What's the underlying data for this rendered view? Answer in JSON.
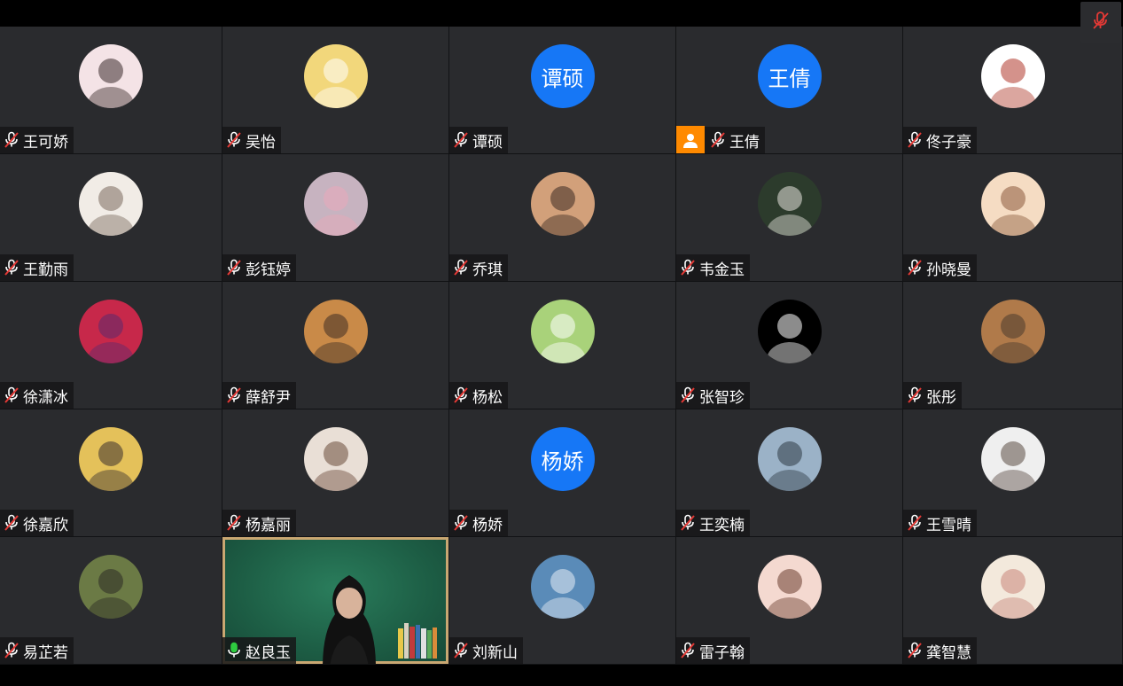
{
  "participants": [
    {
      "name": "王可娇",
      "avatar": "photo-girl",
      "colors": [
        "#f4e3e6",
        "#3a2b2b"
      ]
    },
    {
      "name": "吴怡",
      "avatar": "cartoon-egg",
      "colors": [
        "#f2d77b",
        "#ffffff"
      ]
    },
    {
      "name": "谭硕",
      "avatar_text": "谭硕"
    },
    {
      "name": "王倩",
      "avatar_text": "王倩",
      "host": true
    },
    {
      "name": "佟子豪",
      "avatar": "white-small",
      "colors": [
        "#ffffff",
        "#b0392b"
      ]
    },
    {
      "name": "王勤雨",
      "avatar": "cat",
      "colors": [
        "#f1ece6",
        "#7a6a5d"
      ]
    },
    {
      "name": "彭钰婷",
      "avatar": "photo-girl-pink",
      "colors": [
        "#c7b3c0",
        "#e9a8b9"
      ]
    },
    {
      "name": "乔琪",
      "avatar": "photo-flowers",
      "colors": [
        "#d2a07a",
        "#3b2a22"
      ]
    },
    {
      "name": "韦金玉",
      "avatar": "photo-cap",
      "colors": [
        "#2c3b2c",
        "#e9e6e0"
      ]
    },
    {
      "name": "孙晓曼",
      "avatar": "anime-girl",
      "colors": [
        "#f5dcc3",
        "#8b5a3c"
      ]
    },
    {
      "name": "徐潇冰",
      "avatar": "heart-field",
      "colors": [
        "#c7284a",
        "#5a2a6e"
      ]
    },
    {
      "name": "薛舒尹",
      "avatar": "shiba",
      "colors": [
        "#c98a48",
        "#3e2e25"
      ]
    },
    {
      "name": "杨松",
      "avatar": "cartoon-green",
      "colors": [
        "#a9d27a",
        "#ffffff"
      ]
    },
    {
      "name": "张智珍",
      "avatar": "black-creature",
      "colors": [
        "#000000",
        "#ffffff"
      ]
    },
    {
      "name": "张彤",
      "avatar": "photo-warm",
      "colors": [
        "#b07a4a",
        "#4a3a2e"
      ]
    },
    {
      "name": "徐嘉欣",
      "avatar": "photo-yellow",
      "colors": [
        "#e4c15a",
        "#3a3030"
      ]
    },
    {
      "name": "杨嘉丽",
      "avatar": "anime-nichijou",
      "colors": [
        "#e9dfd6",
        "#6a4a3a"
      ]
    },
    {
      "name": "杨娇",
      "avatar_text": "杨娇"
    },
    {
      "name": "王奕楠",
      "avatar": "palms",
      "colors": [
        "#9bb2c7",
        "#2e3a44"
      ]
    },
    {
      "name": "王雪晴",
      "avatar": "photo-bw",
      "colors": [
        "#efefef",
        "#5b4c44"
      ]
    },
    {
      "name": "易芷若",
      "avatar": "photo-flowers2",
      "colors": [
        "#6b7a45",
        "#2c2a24"
      ]
    },
    {
      "name": "赵良玉",
      "video": true,
      "mic_on": true
    },
    {
      "name": "刘新山",
      "avatar": "mountain",
      "colors": [
        "#5a8bb8",
        "#e8eef5"
      ]
    },
    {
      "name": "雷子翰",
      "avatar": "anime-brown",
      "colors": [
        "#f4d9d0",
        "#6a3d2e"
      ]
    },
    {
      "name": "龚智慧",
      "avatar": "cartoon-pink",
      "colors": [
        "#f3e9dc",
        "#c8857a"
      ]
    }
  ],
  "icons": {
    "muted": "mic-muted-icon",
    "mic_on": "mic-on-icon",
    "host": "person-icon"
  },
  "colors": {
    "tile_bg": "#2a2b2e",
    "text_avatar_bg": "#1677f6",
    "host_badge": "#ff8a00",
    "mute_red": "#e53935",
    "mic_green": "#2ecc40"
  }
}
